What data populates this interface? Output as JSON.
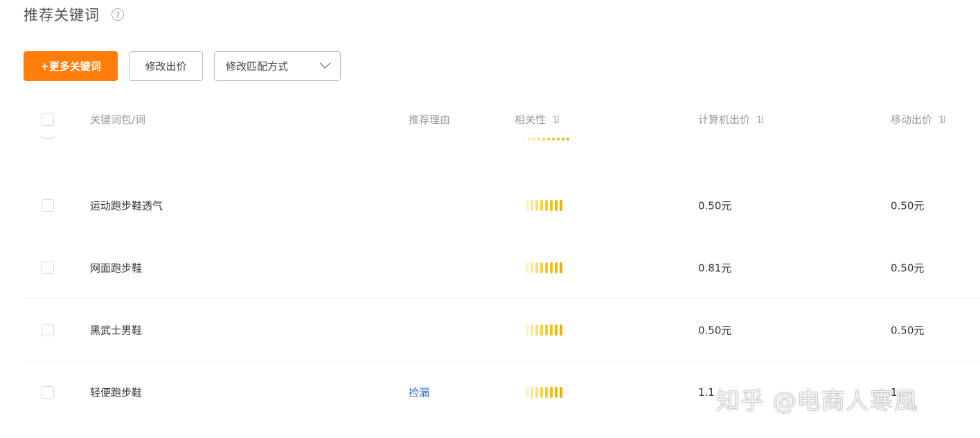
{
  "header": {
    "title": "推荐关键词",
    "help_icon": "question-circle-icon",
    "help_glyph": "?"
  },
  "toolbar": {
    "more_keywords": "+更多关键词",
    "modify_bid": "修改出价",
    "modify_match": "修改匹配方式",
    "accent_color": "#ff7d0a"
  },
  "table": {
    "columns": {
      "keyword": "关键词包/词",
      "reason": "推荐理由",
      "relevance": "相关性",
      "pc_bid": "计算机出价",
      "mobile_bid": "移动出价",
      "sort_glyph": "1l"
    },
    "rows": [
      {
        "keyword": "运动跑步鞋透气",
        "reason": "",
        "relevance_level": 1.0,
        "pc_bid": "0.50元",
        "mobile_bid": "0.50元"
      },
      {
        "keyword": "网面跑步鞋",
        "reason": "",
        "relevance_level": 1.0,
        "pc_bid": "0.81元",
        "mobile_bid": "0.50元"
      },
      {
        "keyword": "黑武士男鞋",
        "reason": "",
        "relevance_level": 1.0,
        "pc_bid": "0.50元",
        "mobile_bid": "0.50元"
      },
      {
        "keyword": "轻便跑步鞋",
        "reason": "捡漏",
        "relevance_level": 1.0,
        "pc_bid": "1.1",
        "mobile_bid": "1."
      }
    ]
  },
  "watermark": "知乎 @电商人寒風"
}
